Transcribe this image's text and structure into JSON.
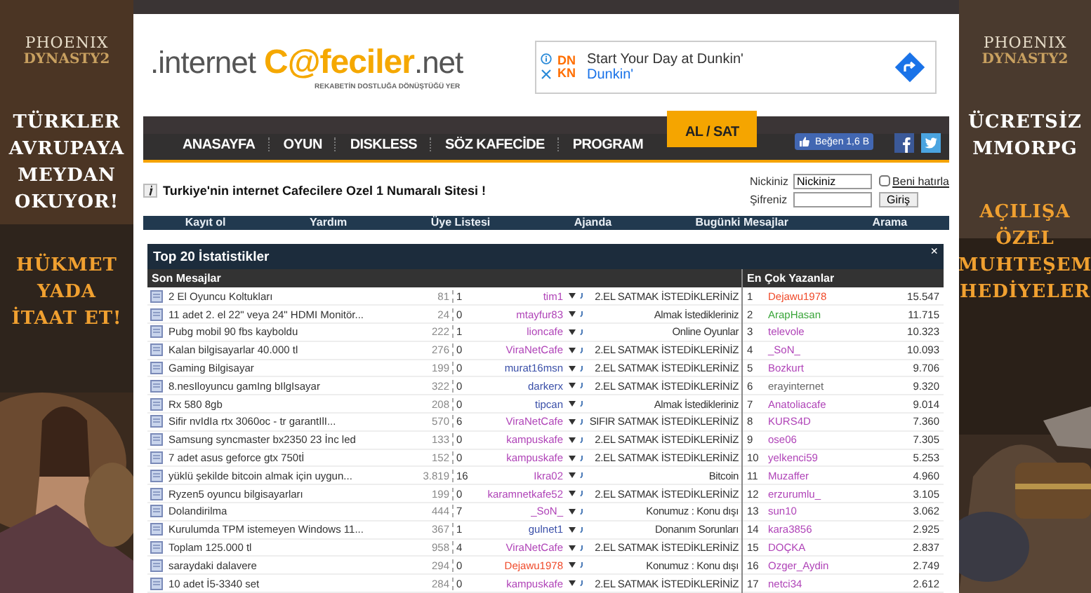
{
  "left_banner": {
    "logo": [
      "PHOENIX",
      "DYNASTY2"
    ],
    "headline": [
      "TÜRKLER",
      "AVRUPAYA",
      "MEYDAN",
      "OKUYOR!"
    ],
    "slogan": [
      "HÜKMET",
      "YADA",
      "İTAAT ET!"
    ]
  },
  "header": {
    "logo": {
      "prefix": ".internet",
      "brand": "C@feciler",
      "suffix": ".net",
      "tagline": "REKABETİN DOSTLUĞA DÖNÜŞTÜĞÜ YER"
    },
    "ad": {
      "logo_lines": [
        "DN",
        "KN"
      ],
      "title": "Start Your Day at Dunkin'",
      "advertiser": "Dunkin'"
    }
  },
  "nav": {
    "items": [
      {
        "label": "ANASAYFA",
        "selected": false
      },
      {
        "label": "OYUN",
        "selected": false
      },
      {
        "label": "DISKLESS",
        "selected": false
      },
      {
        "label": "SÖZ KAFECİDE",
        "selected": false
      },
      {
        "label": "PROGRAM",
        "selected": false
      },
      {
        "label": "AL / SAT",
        "selected": true
      }
    ],
    "like_button": "Beğen 1,6 B"
  },
  "info": {
    "title": "Turkiye'nin internet Cafecilere Ozel 1 Numaralı Sitesi !"
  },
  "login": {
    "nick_label": "Nickiniz",
    "nick_value": "Nickiniz",
    "remember_label": "Beni hatırla",
    "remember": false,
    "password_label": "Şifreniz",
    "submit": "Giriş"
  },
  "menu": [
    "Kayıt ol",
    "Yardım",
    "Üye Listesi",
    "Ajanda",
    "Bugünki Mesajlar",
    "Arama"
  ],
  "stats": {
    "title": "Top 20 İstatistikler",
    "close": "×",
    "posts_heading": "Son Mesajlar",
    "writers_heading": "En Çok Yazanlar",
    "posts": [
      {
        "topic": "2 El Oyuncu Koltukları",
        "views": "81",
        "replies": "1",
        "user": "tim1",
        "color": "#b044b8",
        "forum": "2.EL SATMAK İSTEDİKLERİNİZ"
      },
      {
        "topic": "11 adet 2. el 22\" veya 24\" HDMI Monitör...",
        "views": "24",
        "replies": "0",
        "user": "mtayfur83",
        "color": "#b044b8",
        "forum": "Almak İstedikleriniz"
      },
      {
        "topic": "Pubg mobil 90 fbs kayboldu",
        "views": "222",
        "replies": "1",
        "user": "lioncafe",
        "color": "#b044b8",
        "forum": "Online Oyunlar"
      },
      {
        "topic": "Kalan bilgisayarlar 40.000 tl",
        "views": "276",
        "replies": "0",
        "user": "ViraNetCafe",
        "color": "#b044b8",
        "forum": "2.EL SATMAK İSTEDİKLERİNİZ"
      },
      {
        "topic": "Gaming Bilgisayar",
        "views": "199",
        "replies": "0",
        "user": "murat16msn",
        "color": "#3a4fa8",
        "forum": "2.EL SATMAK İSTEDİKLERİNİZ"
      },
      {
        "topic": "8.nesIloyuncu gamIng bIlgIsayar",
        "views": "322",
        "replies": "0",
        "user": "darkerx",
        "color": "#3a4fa8",
        "forum": "2.EL SATMAK İSTEDİKLERİNİZ"
      },
      {
        "topic": "Rx 580 8gb",
        "views": "208",
        "replies": "0",
        "user": "tipcan",
        "color": "#3a4fa8",
        "forum": "Almak İstedikleriniz"
      },
      {
        "topic": "Sifir nvIdIa rtx 3060oc - tr garantIlI...",
        "views": "570",
        "replies": "6",
        "user": "ViraNetCafe",
        "color": "#b044b8",
        "forum": "SIFIR SATMAK İSTEDİKLERİNİZ"
      },
      {
        "topic": "Samsung syncmaster bx2350 23 İnc led",
        "views": "133",
        "replies": "0",
        "user": "kampuskafe",
        "color": "#b044b8",
        "forum": "2.EL SATMAK İSTEDİKLERİNİZ"
      },
      {
        "topic": "7 adet asus geforce gtx 750tİ",
        "views": "152",
        "replies": "0",
        "user": "kampuskafe",
        "color": "#b044b8",
        "forum": "2.EL SATMAK İSTEDİKLERİNİZ"
      },
      {
        "topic": "yüklü şekilde bitcoin almak için uygun...",
        "views": "3.819",
        "replies": "16",
        "user": "Ikra02",
        "color": "#b044b8",
        "forum": "Bitcoin"
      },
      {
        "topic": "Ryzen5 oyuncu bilgisayarları",
        "views": "199",
        "replies": "0",
        "user": "karamnetkafe52",
        "color": "#b044b8",
        "forum": "2.EL SATMAK İSTEDİKLERİNİZ"
      },
      {
        "topic": "Dolandirilma",
        "views": "444",
        "replies": "7",
        "user": "_SoN_",
        "color": "#b044b8",
        "forum": "Konumuz : Konu dışı"
      },
      {
        "topic": "Kurulumda TPM istemeyen Windows 11...",
        "views": "367",
        "replies": "1",
        "user": "gulnet1",
        "color": "#3a4fa8",
        "forum": "Donanım Sorunları"
      },
      {
        "topic": "Toplam 125.000 tl",
        "views": "958",
        "replies": "4",
        "user": "ViraNetCafe",
        "color": "#b044b8",
        "forum": "2.EL SATMAK İSTEDİKLERİNİZ"
      },
      {
        "topic": "saraydaki dalavere",
        "views": "294",
        "replies": "0",
        "user": "Dejawu1978",
        "color": "#f04a2a",
        "forum": "Konumuz : Konu dışı"
      },
      {
        "topic": "10 adet İ5-3340 set",
        "views": "284",
        "replies": "0",
        "user": "kampuskafe",
        "color": "#b044b8",
        "forum": "2.EL SATMAK İSTEDİKLERİNİZ"
      }
    ],
    "writers": [
      {
        "rank": "1",
        "name": "Dejawu1978",
        "color": "#f04a2a",
        "count": "15.547"
      },
      {
        "rank": "2",
        "name": "ArapHasan",
        "color": "#3aa53a",
        "count": "11.715"
      },
      {
        "rank": "3",
        "name": "televole",
        "color": "#b044b8",
        "count": "10.323"
      },
      {
        "rank": "4",
        "name": "_SoN_",
        "color": "#b044b8",
        "count": "10.093"
      },
      {
        "rank": "5",
        "name": "Bozkurt",
        "color": "#b044b8",
        "count": "9.706"
      },
      {
        "rank": "6",
        "name": "erayinternet",
        "color": "#666666",
        "count": "9.320"
      },
      {
        "rank": "7",
        "name": "Anatoliacafe",
        "color": "#b044b8",
        "count": "9.014"
      },
      {
        "rank": "8",
        "name": "KURS4D",
        "color": "#b044b8",
        "count": "7.360"
      },
      {
        "rank": "9",
        "name": "ose06",
        "color": "#b044b8",
        "count": "7.305"
      },
      {
        "rank": "10",
        "name": "yelkenci59",
        "color": "#b044b8",
        "count": "5.253"
      },
      {
        "rank": "11",
        "name": "Muzaffer",
        "color": "#b044b8",
        "count": "4.960"
      },
      {
        "rank": "12",
        "name": "erzurumlu_",
        "color": "#b044b8",
        "count": "3.105"
      },
      {
        "rank": "13",
        "name": "sun10",
        "color": "#b044b8",
        "count": "3.062"
      },
      {
        "rank": "14",
        "name": "kara3856",
        "color": "#b044b8",
        "count": "2.925"
      },
      {
        "rank": "15",
        "name": "DOÇKA",
        "color": "#b044b8",
        "count": "2.837"
      },
      {
        "rank": "16",
        "name": "Ozger_Aydin",
        "color": "#b044b8",
        "count": "2.749"
      },
      {
        "rank": "17",
        "name": "netci34",
        "color": "#b044b8",
        "count": "2.612"
      }
    ]
  },
  "right_banner": {
    "logo": [
      "PHOENIX",
      "DYNASTY2"
    ],
    "headline": [
      "ÜCRETSİZ",
      "MMORPG"
    ],
    "slogan": [
      "AÇILIŞA",
      "ÖZEL",
      "MUHTEŞEM",
      "HEDİYELER"
    ]
  }
}
